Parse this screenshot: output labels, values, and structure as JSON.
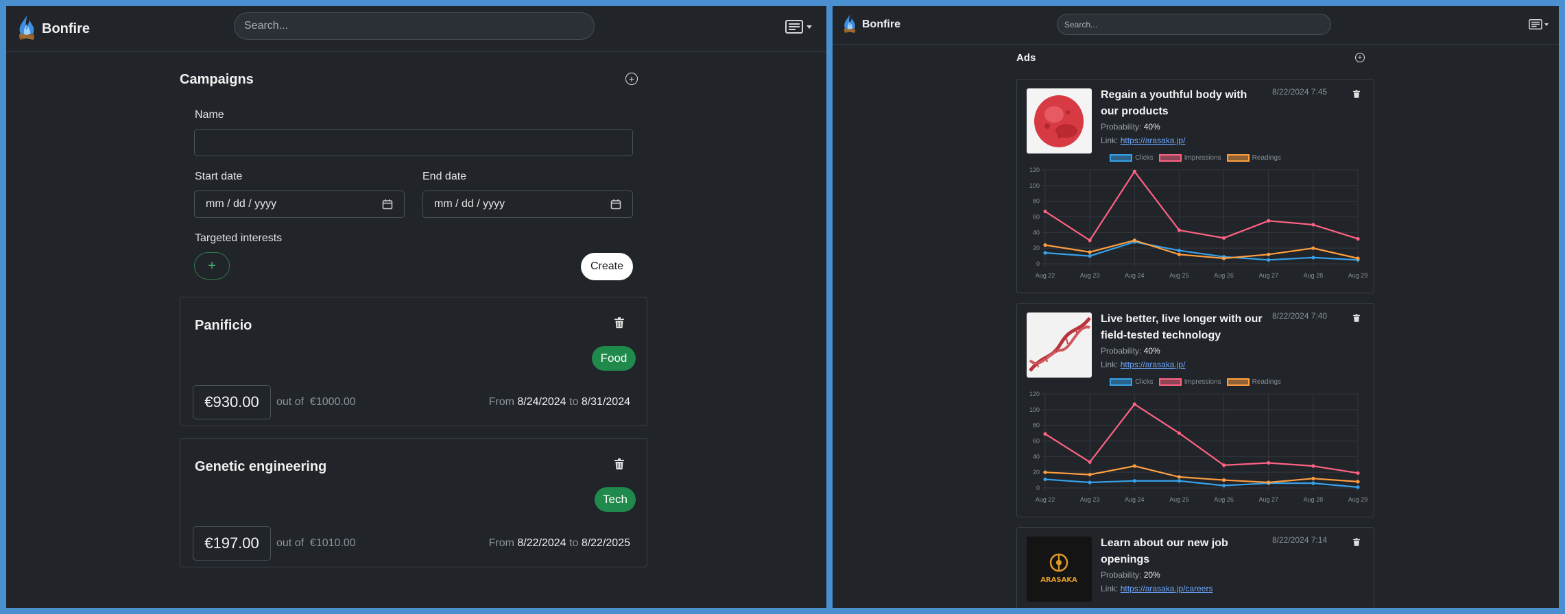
{
  "app": {
    "brand": "Bonfire"
  },
  "left": {
    "search_placeholder": "Search...",
    "section_title": "Campaigns",
    "form": {
      "name_label": "Name",
      "start_label": "Start date",
      "end_label": "End date",
      "date_placeholder": "mm / dd / yyyy",
      "interests_label": "Targeted interests",
      "create_label": "Create"
    },
    "campaigns": [
      {
        "name": "Panificio",
        "tag": "Food",
        "spent": "€930.00",
        "out_of": "out of",
        "budget": "€1000.00",
        "from_label": "From",
        "start": "8/24/2024",
        "to_label": "to",
        "end": "8/31/2024"
      },
      {
        "name": "Genetic engineering",
        "tag": "Tech",
        "spent": "€197.00",
        "out_of": "out of",
        "budget": "€1010.00",
        "from_label": "From",
        "start": "8/22/2024",
        "to_label": "to",
        "end": "8/22/2025"
      }
    ]
  },
  "right": {
    "search_placeholder": "Search...",
    "section_title": "Ads",
    "ads": [
      {
        "title": "Regain a youthful body with our products",
        "date": "8/22/2024 7:45",
        "probability_label": "Probability:",
        "probability": "40%",
        "link_label": "Link:",
        "link": "https://arasaka.jp/",
        "image": "red-cell-image"
      },
      {
        "title": "Live better, live longer with our field-tested technology",
        "date": "8/22/2024 7:40",
        "probability_label": "Probability:",
        "probability": "40%",
        "link_label": "Link:",
        "link": "https://arasaka.jp/",
        "image": "dna-image"
      },
      {
        "title": "Learn about our new job openings",
        "date": "8/22/2024 7:14",
        "probability_label": "Probability:",
        "probability": "20%",
        "link_label": "Link:",
        "link": "https://arasaka.jp/careers",
        "image": "arasaka-logo-image",
        "logo_text": "ARASAKA"
      }
    ]
  },
  "colors": {
    "clicks": "#36a2eb",
    "impressions": "#ff6384",
    "readings": "#ff9f40",
    "tag": "#1f8a4c",
    "background": "#212429"
  },
  "chart_data": [
    {
      "type": "line",
      "categories": [
        "Aug 22",
        "Aug 23",
        "Aug 24",
        "Aug 25",
        "Aug 26",
        "Aug 27",
        "Aug 28",
        "Aug 29"
      ],
      "ylim": [
        0,
        120
      ],
      "yticks": [
        "0",
        "20",
        "40",
        "60",
        "80",
        "100",
        "120"
      ],
      "series": [
        {
          "name": "Clicks",
          "values": [
            14,
            10,
            28,
            17,
            9,
            5,
            8,
            5
          ]
        },
        {
          "name": "Impressions",
          "values": [
            67,
            30,
            118,
            43,
            33,
            55,
            50,
            32
          ]
        },
        {
          "name": "Readings",
          "values": [
            24,
            15,
            30,
            12,
            7,
            12,
            20,
            7
          ]
        }
      ]
    },
    {
      "type": "line",
      "categories": [
        "Aug 22",
        "Aug 23",
        "Aug 24",
        "Aug 25",
        "Aug 26",
        "Aug 27",
        "Aug 28",
        "Aug 29"
      ],
      "ylim": [
        0,
        120
      ],
      "yticks": [
        "0",
        "20",
        "40",
        "60",
        "80",
        "100",
        "120"
      ],
      "series": [
        {
          "name": "Clicks",
          "values": [
            11,
            7,
            9,
            9,
            3,
            6,
            6,
            1
          ]
        },
        {
          "name": "Impressions",
          "values": [
            69,
            33,
            107,
            70,
            29,
            32,
            28,
            19
          ]
        },
        {
          "name": "Readings",
          "values": [
            20,
            17,
            28,
            14,
            10,
            7,
            12,
            8
          ]
        }
      ]
    }
  ]
}
